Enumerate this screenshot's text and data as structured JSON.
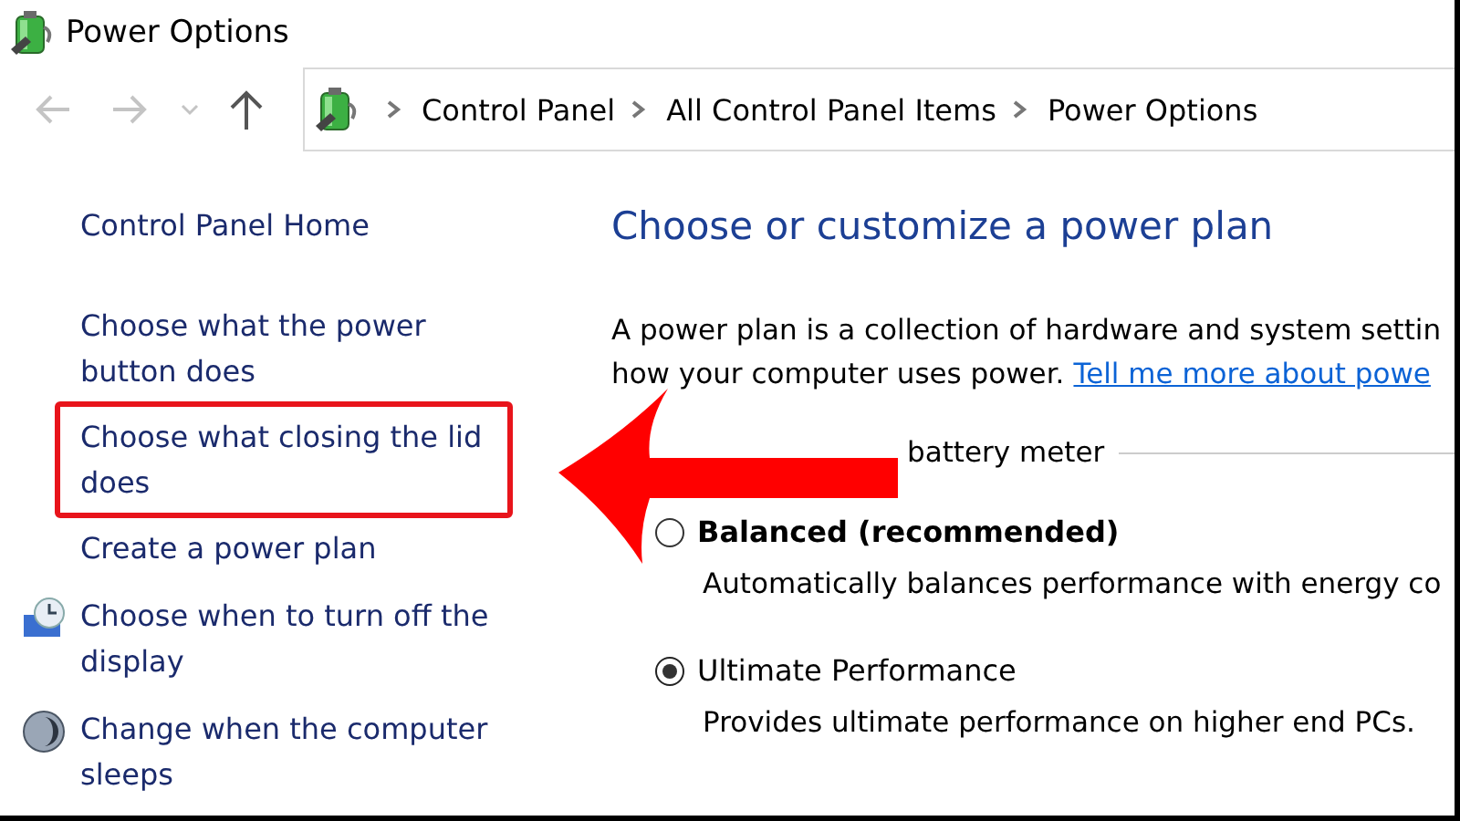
{
  "window": {
    "title": "Power Options"
  },
  "navigation": {
    "back_disabled": true,
    "forward_disabled": true,
    "breadcrumb": [
      "Control Panel",
      "All Control Panel Items",
      "Power Options"
    ]
  },
  "sidebar": {
    "home": "Control Panel Home",
    "items": [
      {
        "kind": "link",
        "label": "Choose what the power button does",
        "highlighted": false
      },
      {
        "kind": "link",
        "label": "Choose what closing the lid does",
        "highlighted": true
      },
      {
        "kind": "link",
        "label": "Create a power plan",
        "highlighted": false
      },
      {
        "kind": "display-link",
        "label": "Choose when to turn off the display",
        "highlighted": false
      },
      {
        "kind": "sleep-link",
        "label": "Change when the computer sleeps",
        "highlighted": false
      }
    ]
  },
  "content": {
    "heading": "Choose or customize a power plan",
    "intro": "A power plan is a collection of hardware and system settin",
    "intro_line2": "how your computer uses power.",
    "intro_link": "Tell me more about powe",
    "section": "battery meter",
    "plans": [
      {
        "name": "Balanced (recommended)",
        "selected": false,
        "description": "Automatically balances performance with energy co"
      },
      {
        "name": "Ultimate Performance",
        "selected": true,
        "description": "Provides ultimate performance on higher end PCs."
      }
    ]
  },
  "annotation": {
    "arrow": true
  }
}
